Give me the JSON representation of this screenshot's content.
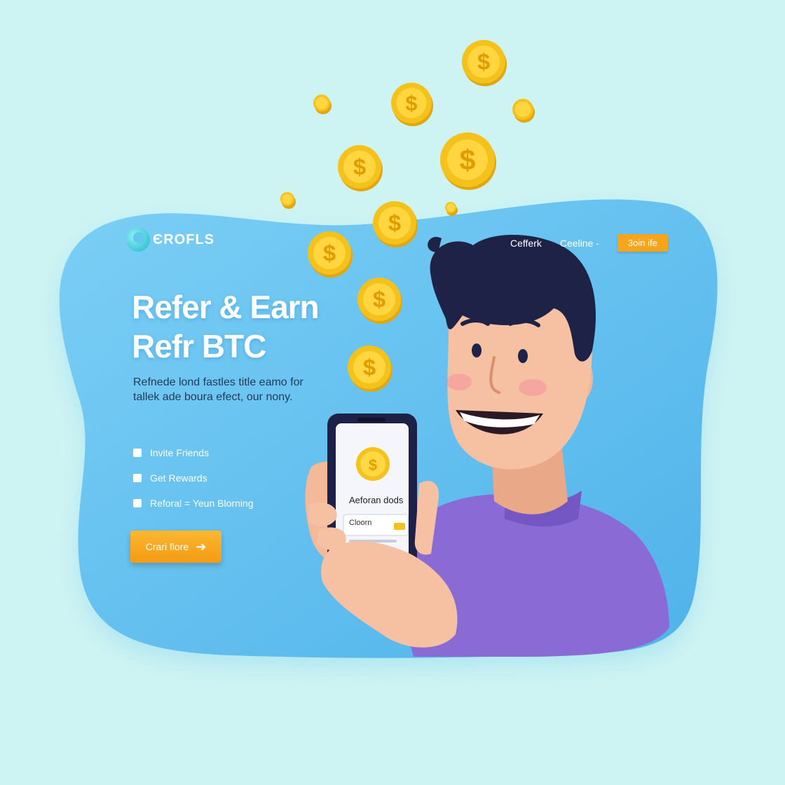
{
  "brand": {
    "name": "ЄROFLS",
    "logo_icon": "wave-logo-icon"
  },
  "nav": {
    "links": [
      "Cefferk",
      "Ceeline -"
    ],
    "join_label": "3oin ife"
  },
  "hero": {
    "headline_line1": "Refer & Earn",
    "headline_line2": "Refr BTC",
    "subtitle": "Refnede lond fastles title eamo for tallek ade boura efect, our nony."
  },
  "features": [
    {
      "label": "Invite Friends"
    },
    {
      "label": "Get Rewards"
    },
    {
      "label": "Reforal = Yeun Blorning"
    }
  ],
  "cta": {
    "label": "Crari flore",
    "icon": "arrow-right-icon"
  },
  "phone": {
    "screen_title": "Aeforan dods",
    "field_label": "Cloorn",
    "coin_icon": "dollar-coin-icon"
  },
  "colors": {
    "background": "#cdf3f3",
    "panel": "#6cc4f1",
    "accent": "#f8a51c",
    "shirt": "#8a6bd6",
    "hair": "#1f2247",
    "coin": "#f5c21b"
  }
}
